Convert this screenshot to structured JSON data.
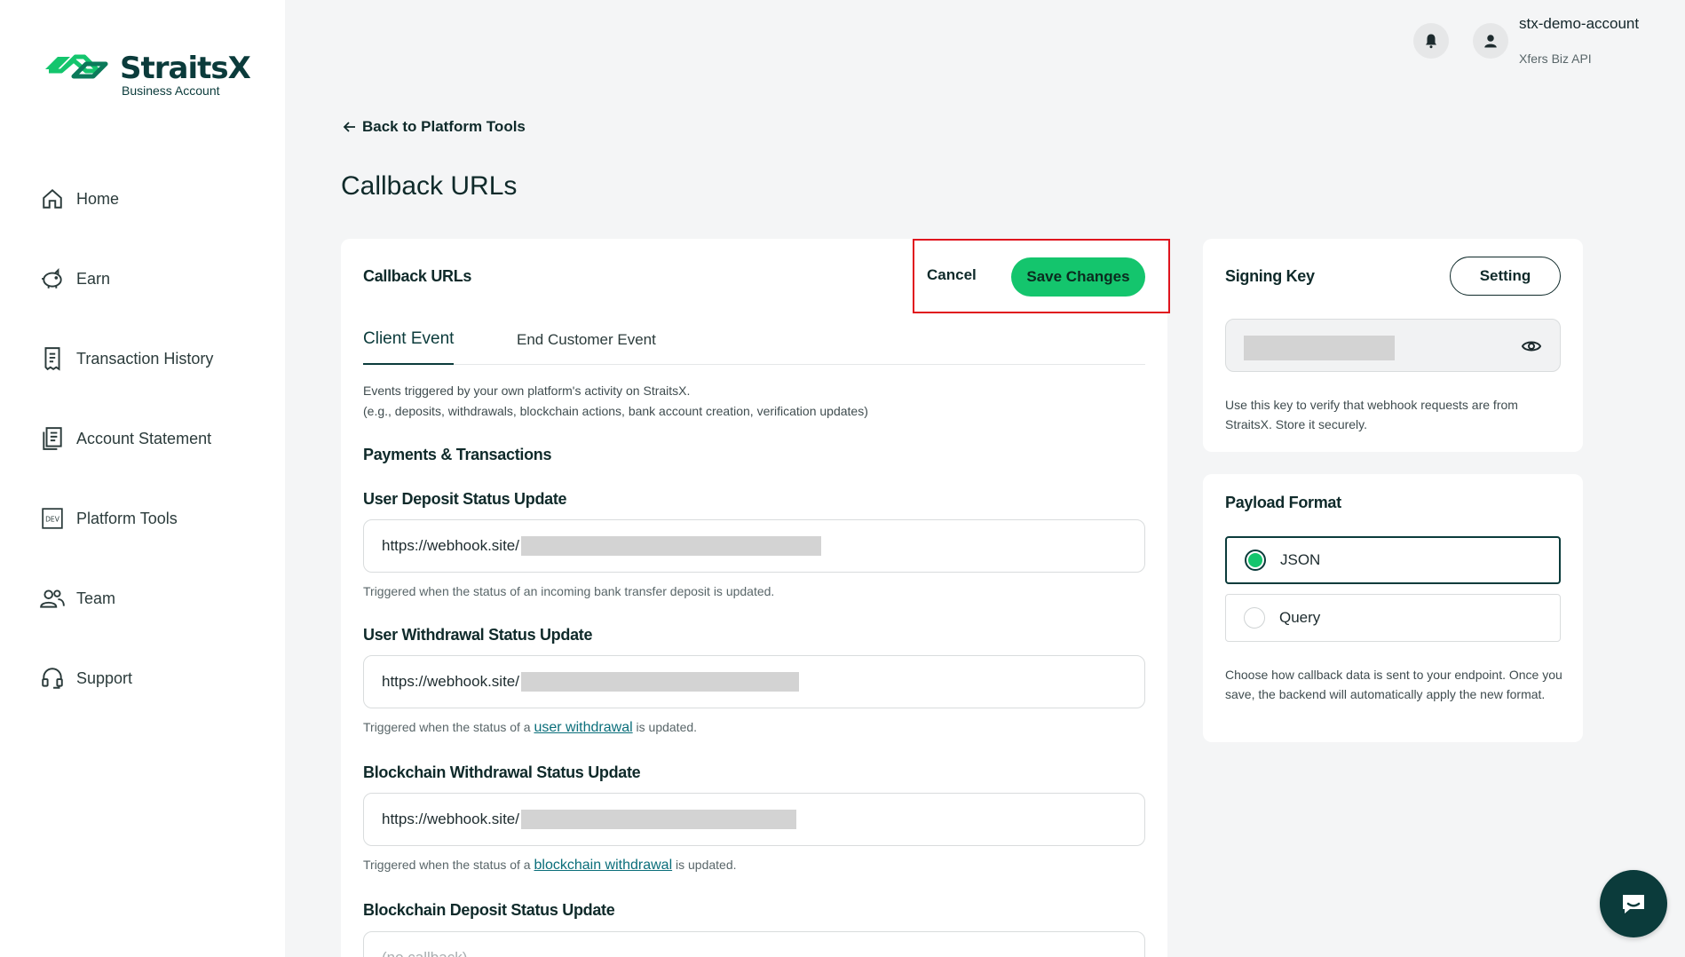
{
  "brand": {
    "name": "StraitsX",
    "subtitle": "Business Account"
  },
  "sidebar": {
    "items": [
      {
        "label": "Home",
        "icon": "home-icon"
      },
      {
        "label": "Earn",
        "icon": "piggy-bank-icon"
      },
      {
        "label": "Transaction History",
        "icon": "receipt-icon"
      },
      {
        "label": "Account Statement",
        "icon": "statement-icon"
      },
      {
        "label": "Platform Tools",
        "icon": "dev-icon"
      },
      {
        "label": "Team",
        "icon": "team-icon"
      },
      {
        "label": "Support",
        "icon": "headset-icon"
      }
    ]
  },
  "header": {
    "username": "stx-demo-account",
    "org": "Xfers Biz API"
  },
  "back_label": "Back to Platform Tools",
  "page_title": "Callback URLs",
  "main": {
    "title": "Callback URLs",
    "cancel_label": "Cancel",
    "save_label": "Save Changes",
    "tabs": [
      {
        "label": "Client Event",
        "active": true
      },
      {
        "label": "End Customer Event",
        "active": false
      }
    ],
    "desc_line1": "Events triggered by your own platform's activity on StraitsX.",
    "desc_line2": "(e.g., deposits, withdrawals, blockchain actions, bank account creation, verification updates)",
    "section": "Payments & Transactions",
    "fields": [
      {
        "label": "User Deposit Status Update",
        "value": "https://webhook.site/",
        "hint": "Triggered when the status of an incoming bank transfer deposit is updated."
      },
      {
        "label": "User Withdrawal Status Update",
        "value": "https://webhook.site/",
        "hint_pre": "Triggered when the status of a ",
        "hint_link": "user withdrawal",
        "hint_post": " is updated."
      },
      {
        "label": "Blockchain Withdrawal Status Update",
        "value": "https://webhook.site/",
        "hint_pre": "Triggered when the status of a ",
        "hint_link": "blockchain withdrawal",
        "hint_post": " is updated."
      },
      {
        "label": "Blockchain Deposit Status Update",
        "placeholder": "(no callback)"
      }
    ]
  },
  "signing": {
    "title": "Signing Key",
    "setting_label": "Setting",
    "desc": "Use this key to verify that webhook requests are from StraitsX. Store it securely."
  },
  "payload": {
    "title": "Payload Format",
    "options": [
      {
        "label": "JSON",
        "selected": true
      },
      {
        "label": "Query",
        "selected": false
      }
    ],
    "desc": "Choose how callback data is sent to your endpoint. Once you save, the backend will automatically apply the new format."
  },
  "colors": {
    "accent": "#14c56d",
    "brand": "#0b3b3b",
    "highlight": "#e0141e"
  }
}
